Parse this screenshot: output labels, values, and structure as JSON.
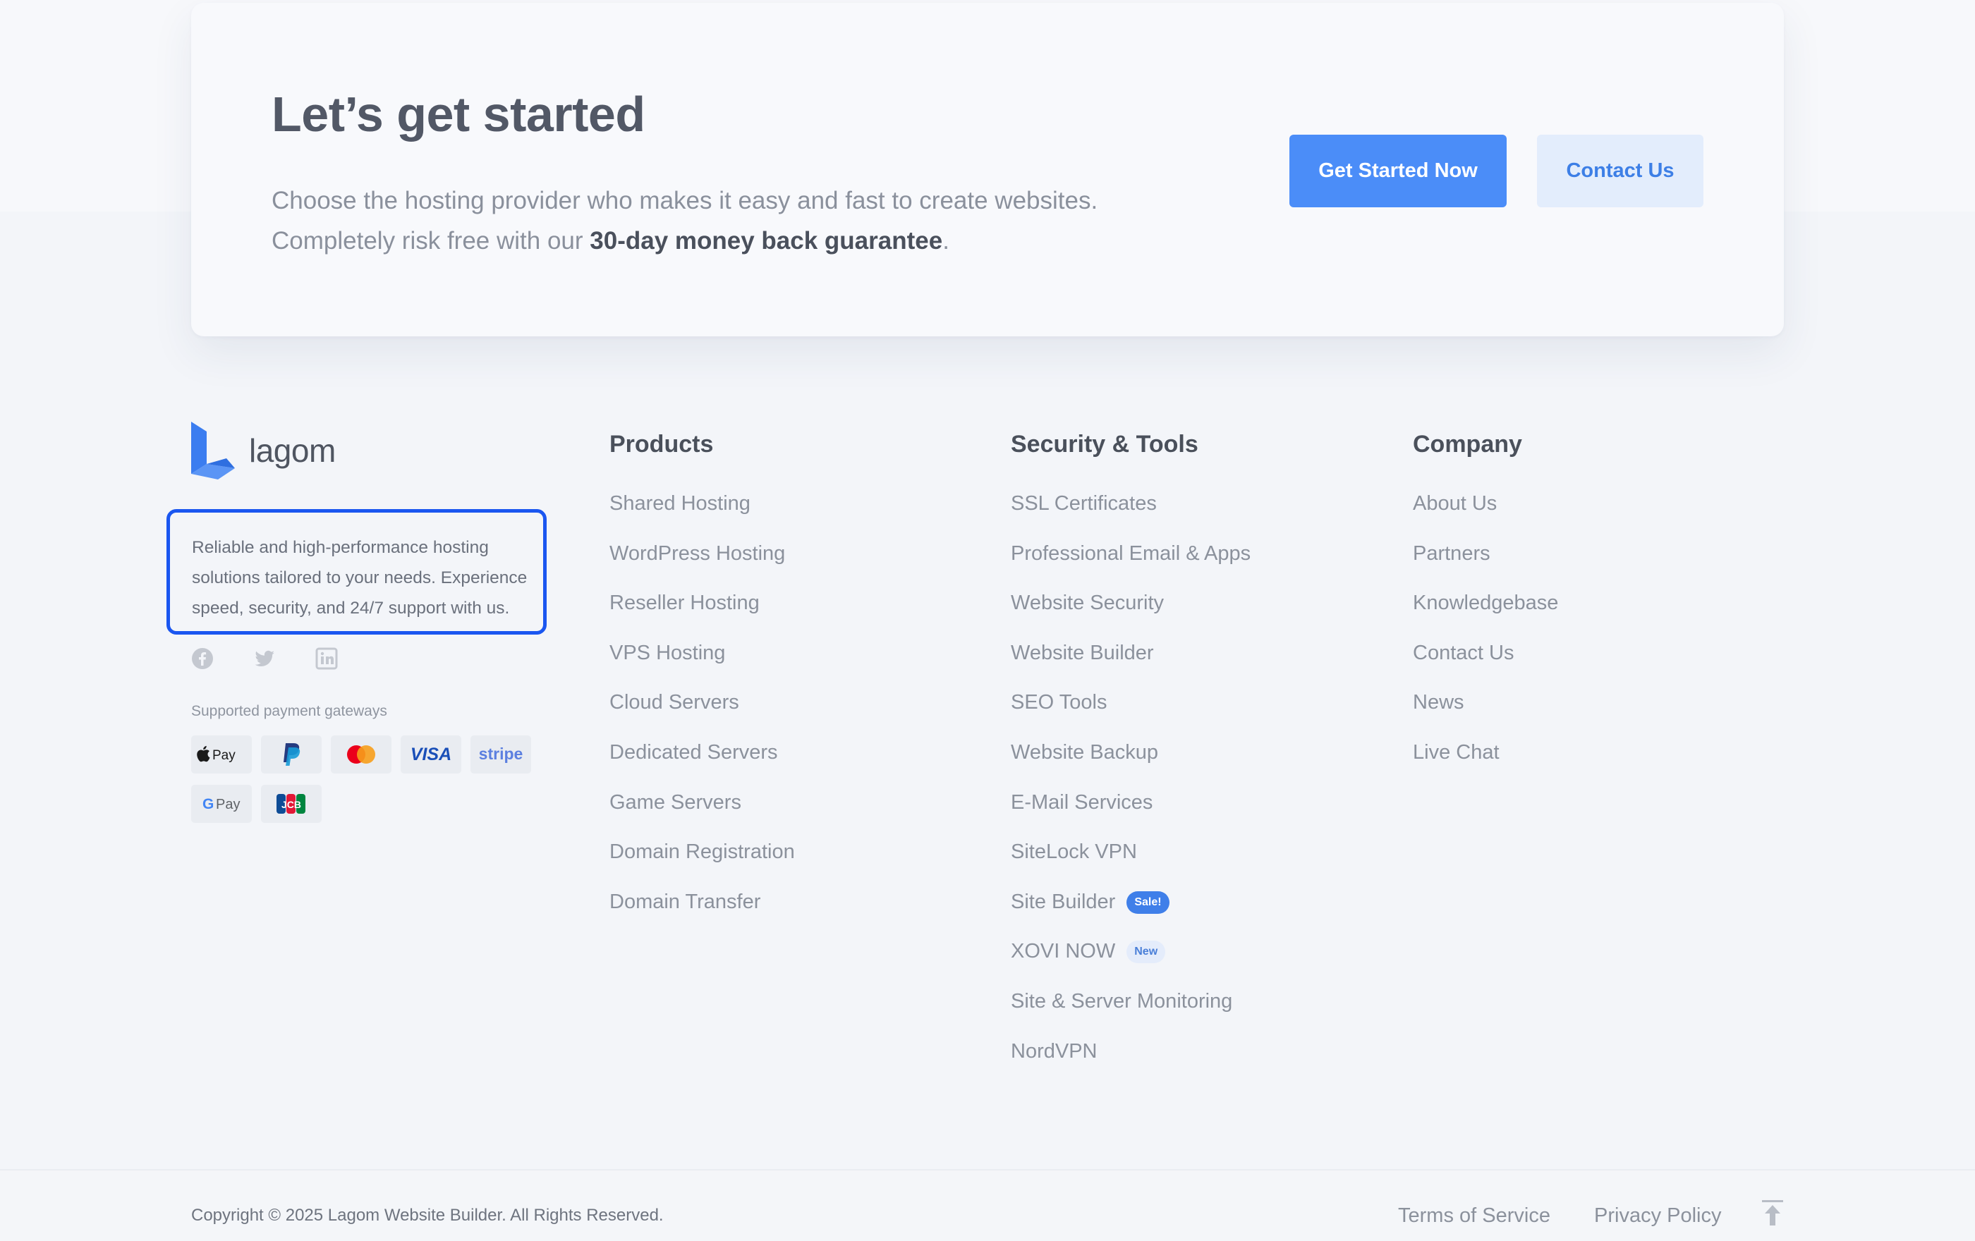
{
  "cta": {
    "title": "Let’s get started",
    "desc_line1": "Choose the hosting provider who makes it easy and fast to create websites.",
    "desc_line2_prefix": "Completely risk free with our ",
    "desc_line2_bold": "30-day money back guarantee",
    "desc_line2_suffix": ".",
    "primary_button": "Get Started Now",
    "secondary_button": "Contact Us"
  },
  "brand": {
    "name": "lagom",
    "description": "Reliable and high-performance hosting solutions tailored to your needs. Experience speed, security, and 24/7 support with us."
  },
  "social": {
    "icons": [
      "facebook-icon",
      "twitter-icon",
      "linkedin-icon"
    ]
  },
  "payments": {
    "label": "Supported payment gateways",
    "gateways": [
      "Apple Pay",
      "PayPal",
      "Mastercard",
      "VISA",
      "stripe",
      "G Pay",
      "JCB"
    ]
  },
  "columns": {
    "products": {
      "title": "Products",
      "items": [
        "Shared Hosting",
        "WordPress Hosting",
        "Reseller Hosting",
        "VPS Hosting",
        "Cloud Servers",
        "Dedicated Servers",
        "Game Servers",
        "Domain Registration",
        "Domain Transfer"
      ]
    },
    "security": {
      "title": "Security & Tools",
      "items": [
        "SSL Certificates",
        "Professional Email & Apps",
        "Website Security",
        "Website Builder",
        "SEO Tools",
        "Website Backup",
        "E-Mail Services",
        "SiteLock VPN",
        "Site Builder",
        "XOVI NOW",
        "Site & Server Monitoring",
        "NordVPN"
      ],
      "badges": {
        "sale": "Sale!",
        "new": "New"
      }
    },
    "company": {
      "title": "Company",
      "items": [
        "About Us",
        "Partners",
        "Knowledgebase",
        "Contact Us",
        "News",
        "Live Chat"
      ]
    }
  },
  "footer": {
    "copyright": "Copyright © 2025 Lagom Website Builder. All Rights Reserved.",
    "terms": "Terms of Service",
    "privacy": "Privacy Policy"
  },
  "colors": {
    "accent": "#4b8df8",
    "accent_light": "#e3edfc",
    "highlight_border": "#1a56f0",
    "brand_logo": "#3b7df0"
  }
}
